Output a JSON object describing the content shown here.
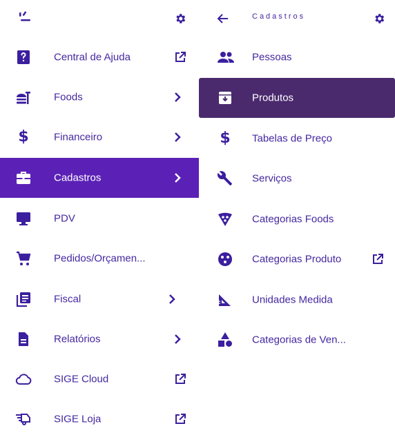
{
  "colors": {
    "accent": "#3b1f9e",
    "active_bg": "#5b21b6",
    "active_sub_bg": "#4a2a6d",
    "text": "#4527a0"
  },
  "left_menu": {
    "items": [
      {
        "label": "Central de Ajuda",
        "icon": "help-icon",
        "trailing": "external-link-icon"
      },
      {
        "label": "Foods",
        "icon": "burger-icon",
        "trailing": "chevron-right-icon"
      },
      {
        "label": "Financeiro",
        "icon": "dollar-icon",
        "trailing": "chevron-right-icon"
      },
      {
        "label": "Cadastros",
        "icon": "briefcase-icon",
        "trailing": "chevron-right-icon",
        "active": true
      },
      {
        "label": "PDV",
        "icon": "monitor-icon",
        "trailing": ""
      },
      {
        "label": "Pedidos/Orçamen...",
        "icon": "cart-icon",
        "trailing": ""
      },
      {
        "label": "Fiscal",
        "icon": "fiscal-icon",
        "trailing": "chevron-right-icon"
      },
      {
        "label": "Relatórios",
        "icon": "document-icon",
        "trailing": "chevron-right-icon"
      },
      {
        "label": "SIGE Cloud",
        "icon": "cloud-icon",
        "trailing": "external-link-icon"
      },
      {
        "label": "SIGE Loja",
        "icon": "truck-icon",
        "trailing": "external-link-icon"
      }
    ]
  },
  "right_menu": {
    "title": "Cadastros",
    "items": [
      {
        "label": "Pessoas",
        "icon": "people-icon",
        "trailing": ""
      },
      {
        "label": "Produtos",
        "icon": "archive-icon",
        "trailing": "",
        "active": true
      },
      {
        "label": "Tabelas de Preço",
        "icon": "dollar-icon",
        "trailing": ""
      },
      {
        "label": "Serviços",
        "icon": "wrench-icon",
        "trailing": ""
      },
      {
        "label": "Categorias Foods",
        "icon": "pizza-icon",
        "trailing": ""
      },
      {
        "label": "Categorias Produto",
        "icon": "palette-icon",
        "trailing": "external-link-icon"
      },
      {
        "label": "Unidades Medida",
        "icon": "set-square-icon",
        "trailing": ""
      },
      {
        "label": "Categorias de Ven...",
        "icon": "shapes-icon",
        "trailing": ""
      }
    ]
  }
}
